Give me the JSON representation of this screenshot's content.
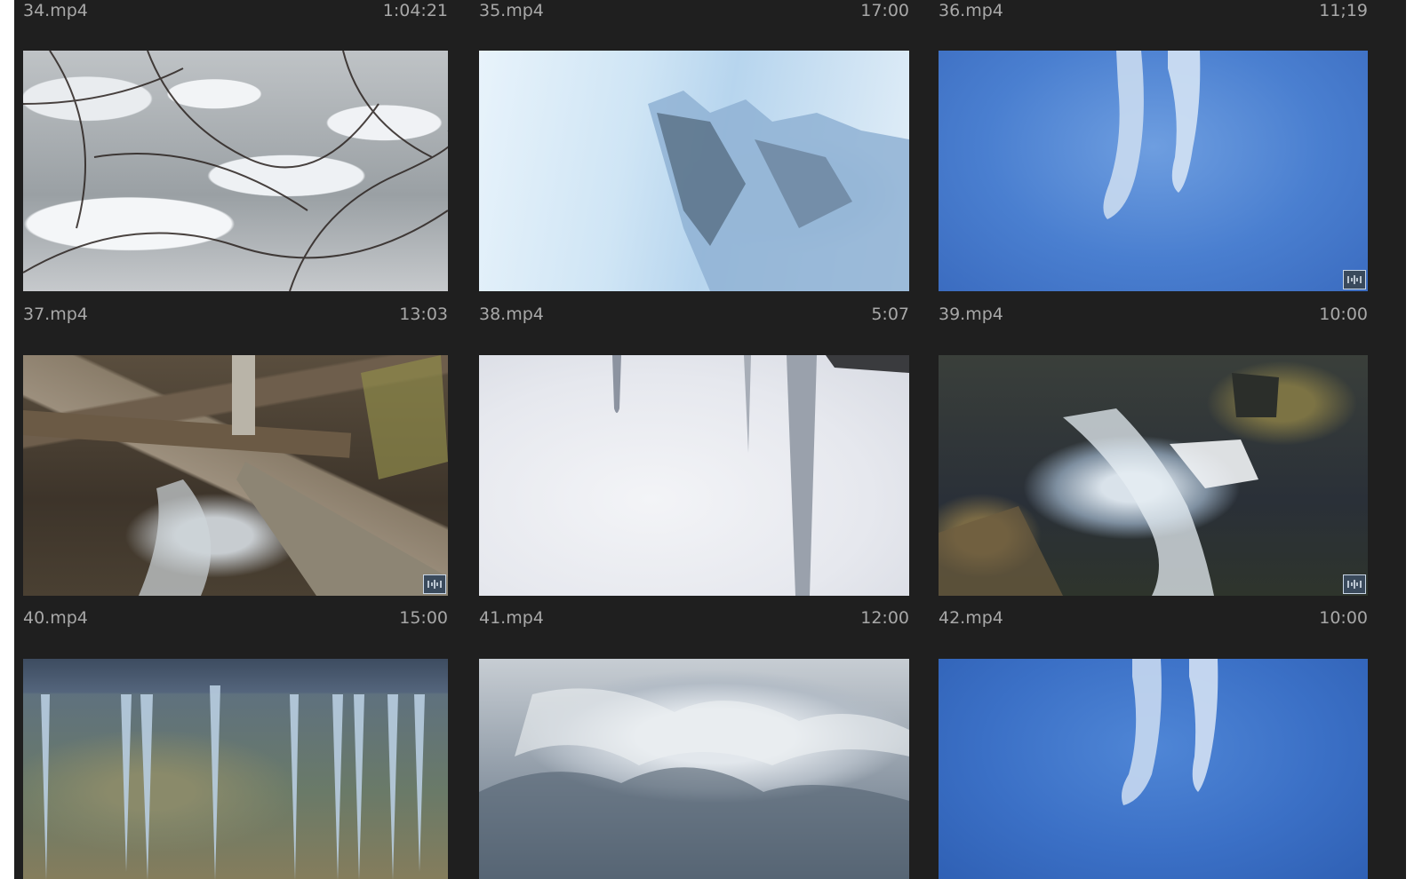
{
  "clips": [
    {
      "name": "34.mp4",
      "duration": "1:04:21"
    },
    {
      "name": "35.mp4",
      "duration": "17:00"
    },
    {
      "name": "36.mp4",
      "duration": "11;19"
    },
    {
      "name": "37.mp4",
      "duration": "13:03",
      "thumb": "snow-covered-branches",
      "audio_badge": false
    },
    {
      "name": "38.mp4",
      "duration": "5:07",
      "thumb": "ice-cave",
      "audio_badge": false
    },
    {
      "name": "39.mp4",
      "duration": "10:00",
      "thumb": "icicles-blue-sky",
      "audio_badge": true
    },
    {
      "name": "40.mp4",
      "duration": "15:00",
      "thumb": "forest-stream-log",
      "audio_badge": true
    },
    {
      "name": "41.mp4",
      "duration": "12:00",
      "thumb": "icicles-white",
      "audio_badge": false
    },
    {
      "name": "42.mp4",
      "duration": "10:00",
      "thumb": "creek-rocks",
      "audio_badge": true
    },
    {
      "thumb": "icicle-row",
      "audio_badge": false
    },
    {
      "thumb": "ice-crystals",
      "audio_badge": false
    },
    {
      "thumb": "icicles-blue-sky",
      "audio_badge": false
    }
  ],
  "icons": {
    "audio_badge": "audio-waveform-icon"
  },
  "colors": {
    "panel_bg": "#1f1f1f",
    "label_text": "#a8a8a8",
    "badge_border": "#c9d6e6"
  }
}
